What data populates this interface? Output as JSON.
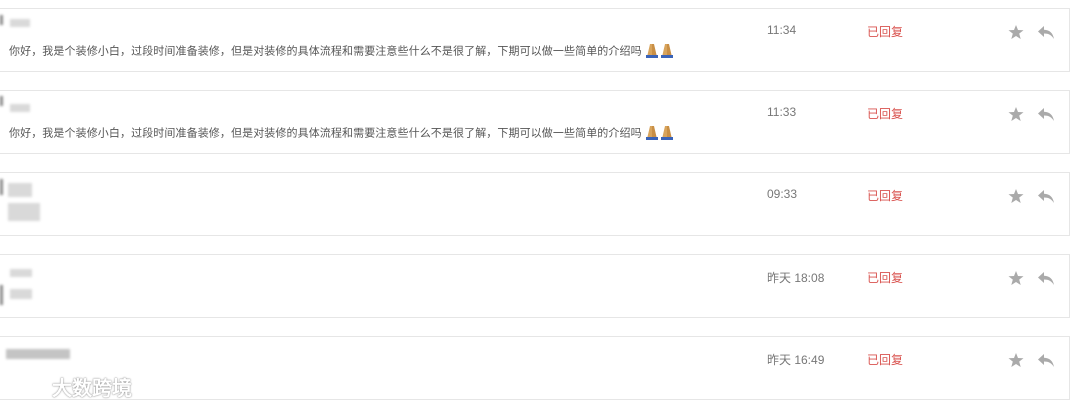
{
  "messages": [
    {
      "text": "你好，我是个装修小白，过段时间准备装修，但是对装修的具体流程和需要注意些什么不是很了解，下期可以做一些简单的介绍吗",
      "time": "11:34",
      "status": "已回复",
      "emoji": "pray-hands-icon"
    },
    {
      "text": "你好，我是个装修小白，过段时间准备装修，但是对装修的具体流程和需要注意些什么不是很了解，下期可以做一些简单的介绍吗",
      "time": "11:33",
      "status": "已回复",
      "emoji": "pray-hands-icon"
    },
    {
      "text": "",
      "time": "09:33",
      "status": "已回复"
    },
    {
      "text": "",
      "time": "昨天 18:08",
      "status": "已回复"
    },
    {
      "text": "",
      "time": "昨天 16:49",
      "status": "已回复"
    }
  ],
  "colors": {
    "status": "#d9534f",
    "time": "#777777",
    "icon": "#aaaaaa",
    "border": "#e6e6e6"
  },
  "watermark": {
    "text": "大数跨境"
  }
}
